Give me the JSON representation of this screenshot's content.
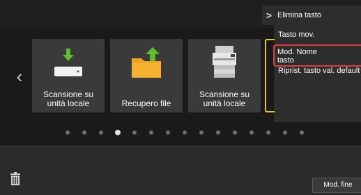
{
  "tiles": [
    {
      "label": "Scansione su\nunità locale",
      "icon": "download-to-device-icon"
    },
    {
      "label": "Recupero file",
      "icon": "folder-upload-icon"
    },
    {
      "label": "Scansione su\nunità locale",
      "icon": "printer-icon"
    }
  ],
  "menu": {
    "header_label": "Elimina tasto",
    "items": [
      "Tasto mov.",
      "Mod. Nome\ntasto",
      "Riprist. tasto val. default"
    ]
  },
  "pagination": {
    "count": 15,
    "active_index": 3
  },
  "bottom": {
    "finish_label": "Mod. fine"
  },
  "colors": {
    "highlight": "#e23a4a",
    "tile_border": "#e6c640",
    "accent_green": "#5fbf2a",
    "folder_orange": "#f0a020"
  }
}
